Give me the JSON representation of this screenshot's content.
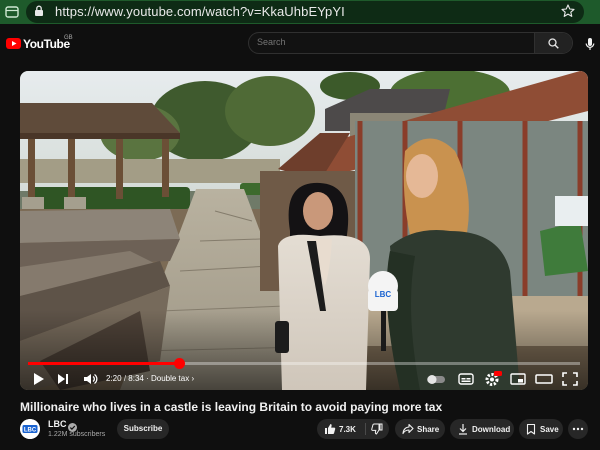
{
  "browser": {
    "url": "https://www.youtube.com/watch?v=KkaUhbEYpYI",
    "icons": [
      "tab-icon",
      "site-info-icon",
      "bookmark-star-icon"
    ]
  },
  "masthead": {
    "logo_text": "YouTube",
    "region": "GB",
    "search_placeholder": "Search",
    "icons": [
      "search-icon",
      "microphone-icon"
    ]
  },
  "player": {
    "current_time": "2:20",
    "separator": "/",
    "duration": "8:34",
    "chapter": "· Double tax",
    "progress_fraction": 0.273,
    "controls": [
      "play-icon",
      "next-icon",
      "volume-icon",
      "autoplay-toggle",
      "subtitles-icon",
      "settings-icon",
      "miniplayer-icon",
      "theater-icon",
      "fullscreen-icon"
    ],
    "accent_color": "#ff0000"
  },
  "video": {
    "title": "Millionaire who lives in a castle is leaving Britain to avoid paying more tax"
  },
  "channel": {
    "name": "LBC",
    "subscribers": "1.22M subscribers",
    "subscribe_label": "Subscribe",
    "avatar_text": "LBC"
  },
  "actions": {
    "likes": "7.3K",
    "share": "Share",
    "download": "Download",
    "save": "Save",
    "mic_logo_text": "LBC"
  }
}
